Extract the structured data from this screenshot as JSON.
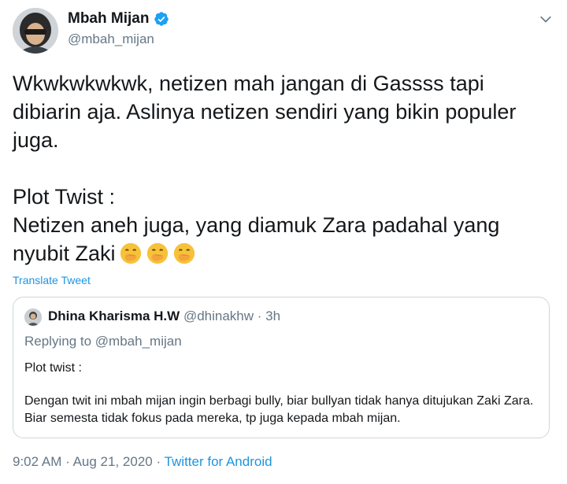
{
  "author": {
    "display_name": "Mbah Mijan",
    "handle": "@mbah_mijan",
    "verified": true
  },
  "tweet": {
    "text": "Wkwkwkwkwk, netizen mah jangan di Gassss tapi dibiarin aja. Aslinya netizen sendiri yang bikin populer juga.\n\nPlot Twist :\nNetizen aneh juga, yang diamuk Zara padahal yang nyubit Zaki",
    "emojis": [
      "face-with-hand-over-mouth",
      "face-with-hand-over-mouth",
      "face-with-hand-over-mouth"
    ],
    "translate_label": "Translate Tweet"
  },
  "quoted_tweet": {
    "display_name": "Dhina Kharisma H.W",
    "handle": "@dhinakhw",
    "separator": "·",
    "time": "3h",
    "replying_prefix": "Replying to",
    "replying_to": "@mbah_mijan",
    "text_line1": "Plot twist :",
    "text_line2": "Dengan twit ini mbah mijan ingin berbagi bully, biar bullyan tidak hanya ditujukan Zaki Zara. Biar semesta tidak fokus pada mereka, tp juga kepada mbah mijan."
  },
  "footer": {
    "time": "9:02 AM",
    "separator": "·",
    "date": "Aug 21, 2020",
    "source": "Twitter for Android"
  },
  "colors": {
    "link": "#1b95e0",
    "muted": "#657786",
    "border": "#ccd6dd",
    "verified": "#1da1f2",
    "emoji": "#f7c23a"
  },
  "icons": {
    "verified": "verified-badge-icon",
    "menu": "chevron-down-icon"
  }
}
